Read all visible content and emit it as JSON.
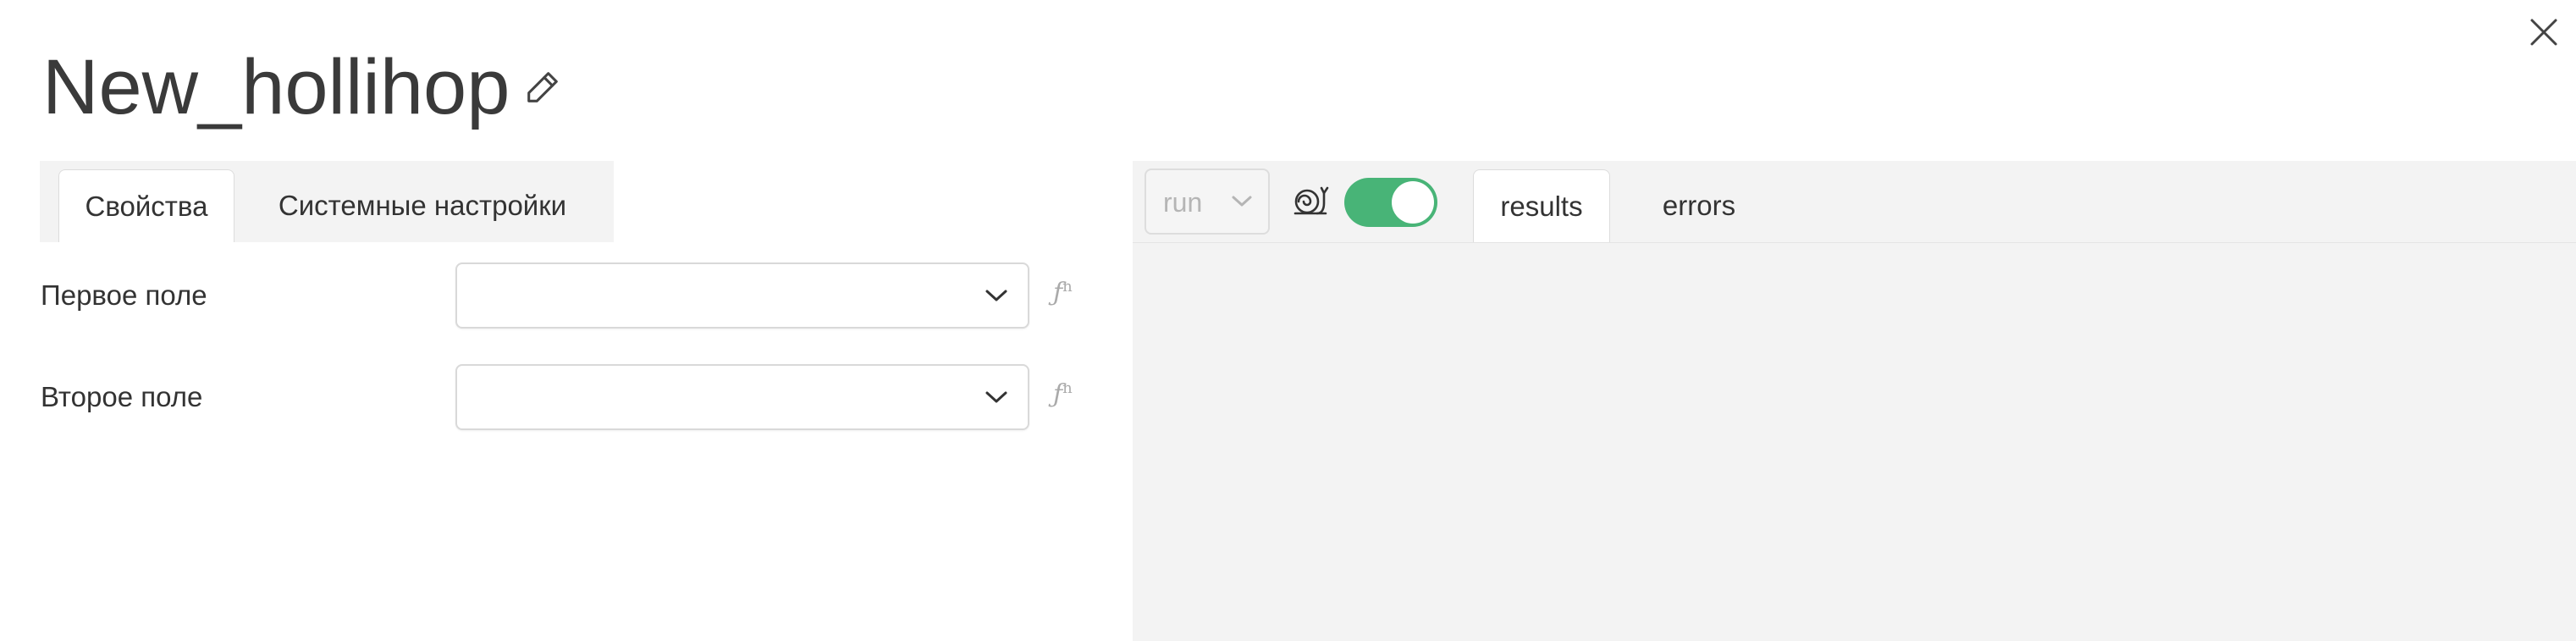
{
  "header": {
    "title": "New_hollihop",
    "edit_icon": "pencil-icon",
    "close_icon": "close-icon"
  },
  "left_panel": {
    "tabs": [
      {
        "label": "Свойства",
        "active": true
      },
      {
        "label": "Системные настройки",
        "active": false
      }
    ],
    "fields": [
      {
        "label": "Первое поле",
        "value": "",
        "fn_label": "ƒ",
        "fn_sup": "n"
      },
      {
        "label": "Второе поле",
        "value": "",
        "fn_label": "ƒ",
        "fn_sup": "n"
      }
    ]
  },
  "right_panel": {
    "run_select": {
      "value": "run"
    },
    "snail_icon": "snail-icon",
    "toggle": {
      "on": true,
      "color": "#48b477"
    },
    "tabs": [
      {
        "label": "results",
        "active": true
      },
      {
        "label": "errors",
        "active": false
      }
    ]
  },
  "colors": {
    "accent_green": "#48b477",
    "panel_bg": "#f3f3f3"
  }
}
